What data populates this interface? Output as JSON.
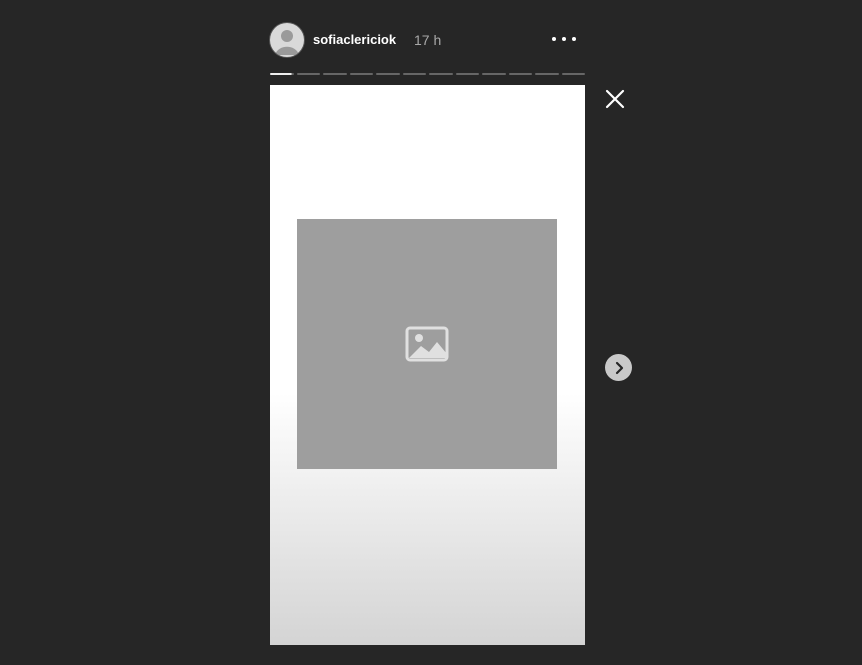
{
  "header": {
    "username": "sofiaclericiok",
    "time": "17 h",
    "avatar_icon": "profile-avatar-icon",
    "more_icon": "more-options-icon"
  },
  "progress": {
    "total_segments": 12,
    "active_index": 0,
    "active_fraction": 0.9
  },
  "story": {
    "media_icon": "photo-icon"
  },
  "controls": {
    "close_icon": "close-icon",
    "next_icon": "chevron-right-icon"
  },
  "colors": {
    "background": "#262626",
    "story_bg": "#ffffff",
    "text_primary": "#ffffff",
    "text_secondary": "#a8a8a8"
  }
}
